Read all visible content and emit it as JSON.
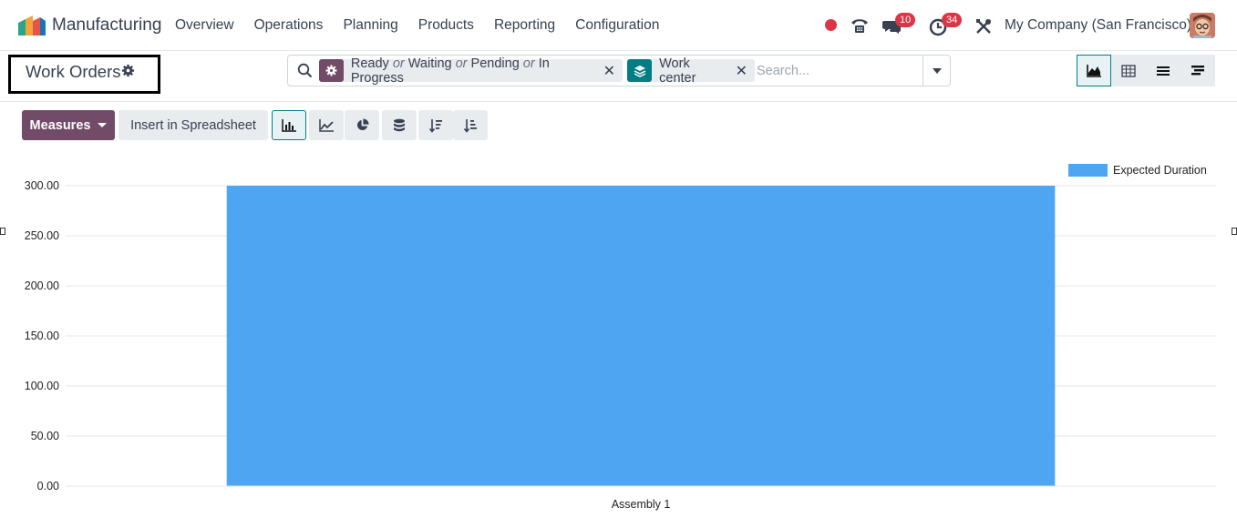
{
  "navbar": {
    "app_name": "Manufacturing",
    "menu": [
      "Overview",
      "Operations",
      "Planning",
      "Products",
      "Reporting",
      "Configuration"
    ],
    "chat_count": "10",
    "activity_count": "34",
    "company": "My Company (San Francisco)"
  },
  "control_panel": {
    "title": "Work Orders",
    "filter_facet": {
      "values": [
        "Ready",
        "Waiting",
        "Pending",
        "In Progress"
      ],
      "separator": "or"
    },
    "group_facet": {
      "value": "Work center"
    },
    "search_placeholder": "Search..."
  },
  "toolbar": {
    "measures_label": "Measures",
    "spreadsheet_label": "Insert in Spreadsheet"
  },
  "colors": {
    "brand": "#714b67",
    "accent": "#017e84",
    "bar": "#4ea6f2",
    "alert": "#dc3545"
  },
  "chart_data": {
    "type": "bar",
    "categories": [
      "Assembly 1"
    ],
    "series": [
      {
        "name": "Expected Duration",
        "values": [
          300
        ]
      }
    ],
    "ylim": [
      0,
      300
    ],
    "yticks": [
      "0.00",
      "50.00",
      "100.00",
      "150.00",
      "200.00",
      "250.00",
      "300.00"
    ],
    "grid": true,
    "legend": "top-right"
  }
}
